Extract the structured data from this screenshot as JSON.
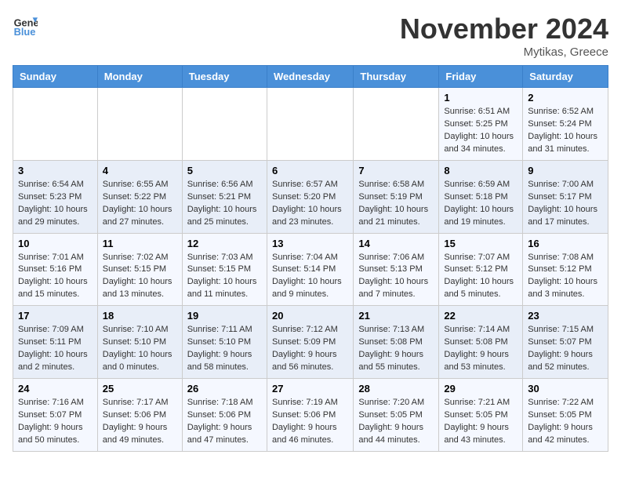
{
  "header": {
    "logo_general": "General",
    "logo_blue": "Blue",
    "month_title": "November 2024",
    "location": "Mytikas, Greece"
  },
  "weekdays": [
    "Sunday",
    "Monday",
    "Tuesday",
    "Wednesday",
    "Thursday",
    "Friday",
    "Saturday"
  ],
  "weeks": [
    [
      {
        "day": "",
        "info": ""
      },
      {
        "day": "",
        "info": ""
      },
      {
        "day": "",
        "info": ""
      },
      {
        "day": "",
        "info": ""
      },
      {
        "day": "",
        "info": ""
      },
      {
        "day": "1",
        "info": "Sunrise: 6:51 AM\nSunset: 5:25 PM\nDaylight: 10 hours and 34 minutes."
      },
      {
        "day": "2",
        "info": "Sunrise: 6:52 AM\nSunset: 5:24 PM\nDaylight: 10 hours and 31 minutes."
      }
    ],
    [
      {
        "day": "3",
        "info": "Sunrise: 6:54 AM\nSunset: 5:23 PM\nDaylight: 10 hours and 29 minutes."
      },
      {
        "day": "4",
        "info": "Sunrise: 6:55 AM\nSunset: 5:22 PM\nDaylight: 10 hours and 27 minutes."
      },
      {
        "day": "5",
        "info": "Sunrise: 6:56 AM\nSunset: 5:21 PM\nDaylight: 10 hours and 25 minutes."
      },
      {
        "day": "6",
        "info": "Sunrise: 6:57 AM\nSunset: 5:20 PM\nDaylight: 10 hours and 23 minutes."
      },
      {
        "day": "7",
        "info": "Sunrise: 6:58 AM\nSunset: 5:19 PM\nDaylight: 10 hours and 21 minutes."
      },
      {
        "day": "8",
        "info": "Sunrise: 6:59 AM\nSunset: 5:18 PM\nDaylight: 10 hours and 19 minutes."
      },
      {
        "day": "9",
        "info": "Sunrise: 7:00 AM\nSunset: 5:17 PM\nDaylight: 10 hours and 17 minutes."
      }
    ],
    [
      {
        "day": "10",
        "info": "Sunrise: 7:01 AM\nSunset: 5:16 PM\nDaylight: 10 hours and 15 minutes."
      },
      {
        "day": "11",
        "info": "Sunrise: 7:02 AM\nSunset: 5:15 PM\nDaylight: 10 hours and 13 minutes."
      },
      {
        "day": "12",
        "info": "Sunrise: 7:03 AM\nSunset: 5:15 PM\nDaylight: 10 hours and 11 minutes."
      },
      {
        "day": "13",
        "info": "Sunrise: 7:04 AM\nSunset: 5:14 PM\nDaylight: 10 hours and 9 minutes."
      },
      {
        "day": "14",
        "info": "Sunrise: 7:06 AM\nSunset: 5:13 PM\nDaylight: 10 hours and 7 minutes."
      },
      {
        "day": "15",
        "info": "Sunrise: 7:07 AM\nSunset: 5:12 PM\nDaylight: 10 hours and 5 minutes."
      },
      {
        "day": "16",
        "info": "Sunrise: 7:08 AM\nSunset: 5:12 PM\nDaylight: 10 hours and 3 minutes."
      }
    ],
    [
      {
        "day": "17",
        "info": "Sunrise: 7:09 AM\nSunset: 5:11 PM\nDaylight: 10 hours and 2 minutes."
      },
      {
        "day": "18",
        "info": "Sunrise: 7:10 AM\nSunset: 5:10 PM\nDaylight: 10 hours and 0 minutes."
      },
      {
        "day": "19",
        "info": "Sunrise: 7:11 AM\nSunset: 5:10 PM\nDaylight: 9 hours and 58 minutes."
      },
      {
        "day": "20",
        "info": "Sunrise: 7:12 AM\nSunset: 5:09 PM\nDaylight: 9 hours and 56 minutes."
      },
      {
        "day": "21",
        "info": "Sunrise: 7:13 AM\nSunset: 5:08 PM\nDaylight: 9 hours and 55 minutes."
      },
      {
        "day": "22",
        "info": "Sunrise: 7:14 AM\nSunset: 5:08 PM\nDaylight: 9 hours and 53 minutes."
      },
      {
        "day": "23",
        "info": "Sunrise: 7:15 AM\nSunset: 5:07 PM\nDaylight: 9 hours and 52 minutes."
      }
    ],
    [
      {
        "day": "24",
        "info": "Sunrise: 7:16 AM\nSunset: 5:07 PM\nDaylight: 9 hours and 50 minutes."
      },
      {
        "day": "25",
        "info": "Sunrise: 7:17 AM\nSunset: 5:06 PM\nDaylight: 9 hours and 49 minutes."
      },
      {
        "day": "26",
        "info": "Sunrise: 7:18 AM\nSunset: 5:06 PM\nDaylight: 9 hours and 47 minutes."
      },
      {
        "day": "27",
        "info": "Sunrise: 7:19 AM\nSunset: 5:06 PM\nDaylight: 9 hours and 46 minutes."
      },
      {
        "day": "28",
        "info": "Sunrise: 7:20 AM\nSunset: 5:05 PM\nDaylight: 9 hours and 44 minutes."
      },
      {
        "day": "29",
        "info": "Sunrise: 7:21 AM\nSunset: 5:05 PM\nDaylight: 9 hours and 43 minutes."
      },
      {
        "day": "30",
        "info": "Sunrise: 7:22 AM\nSunset: 5:05 PM\nDaylight: 9 hours and 42 minutes."
      }
    ]
  ]
}
